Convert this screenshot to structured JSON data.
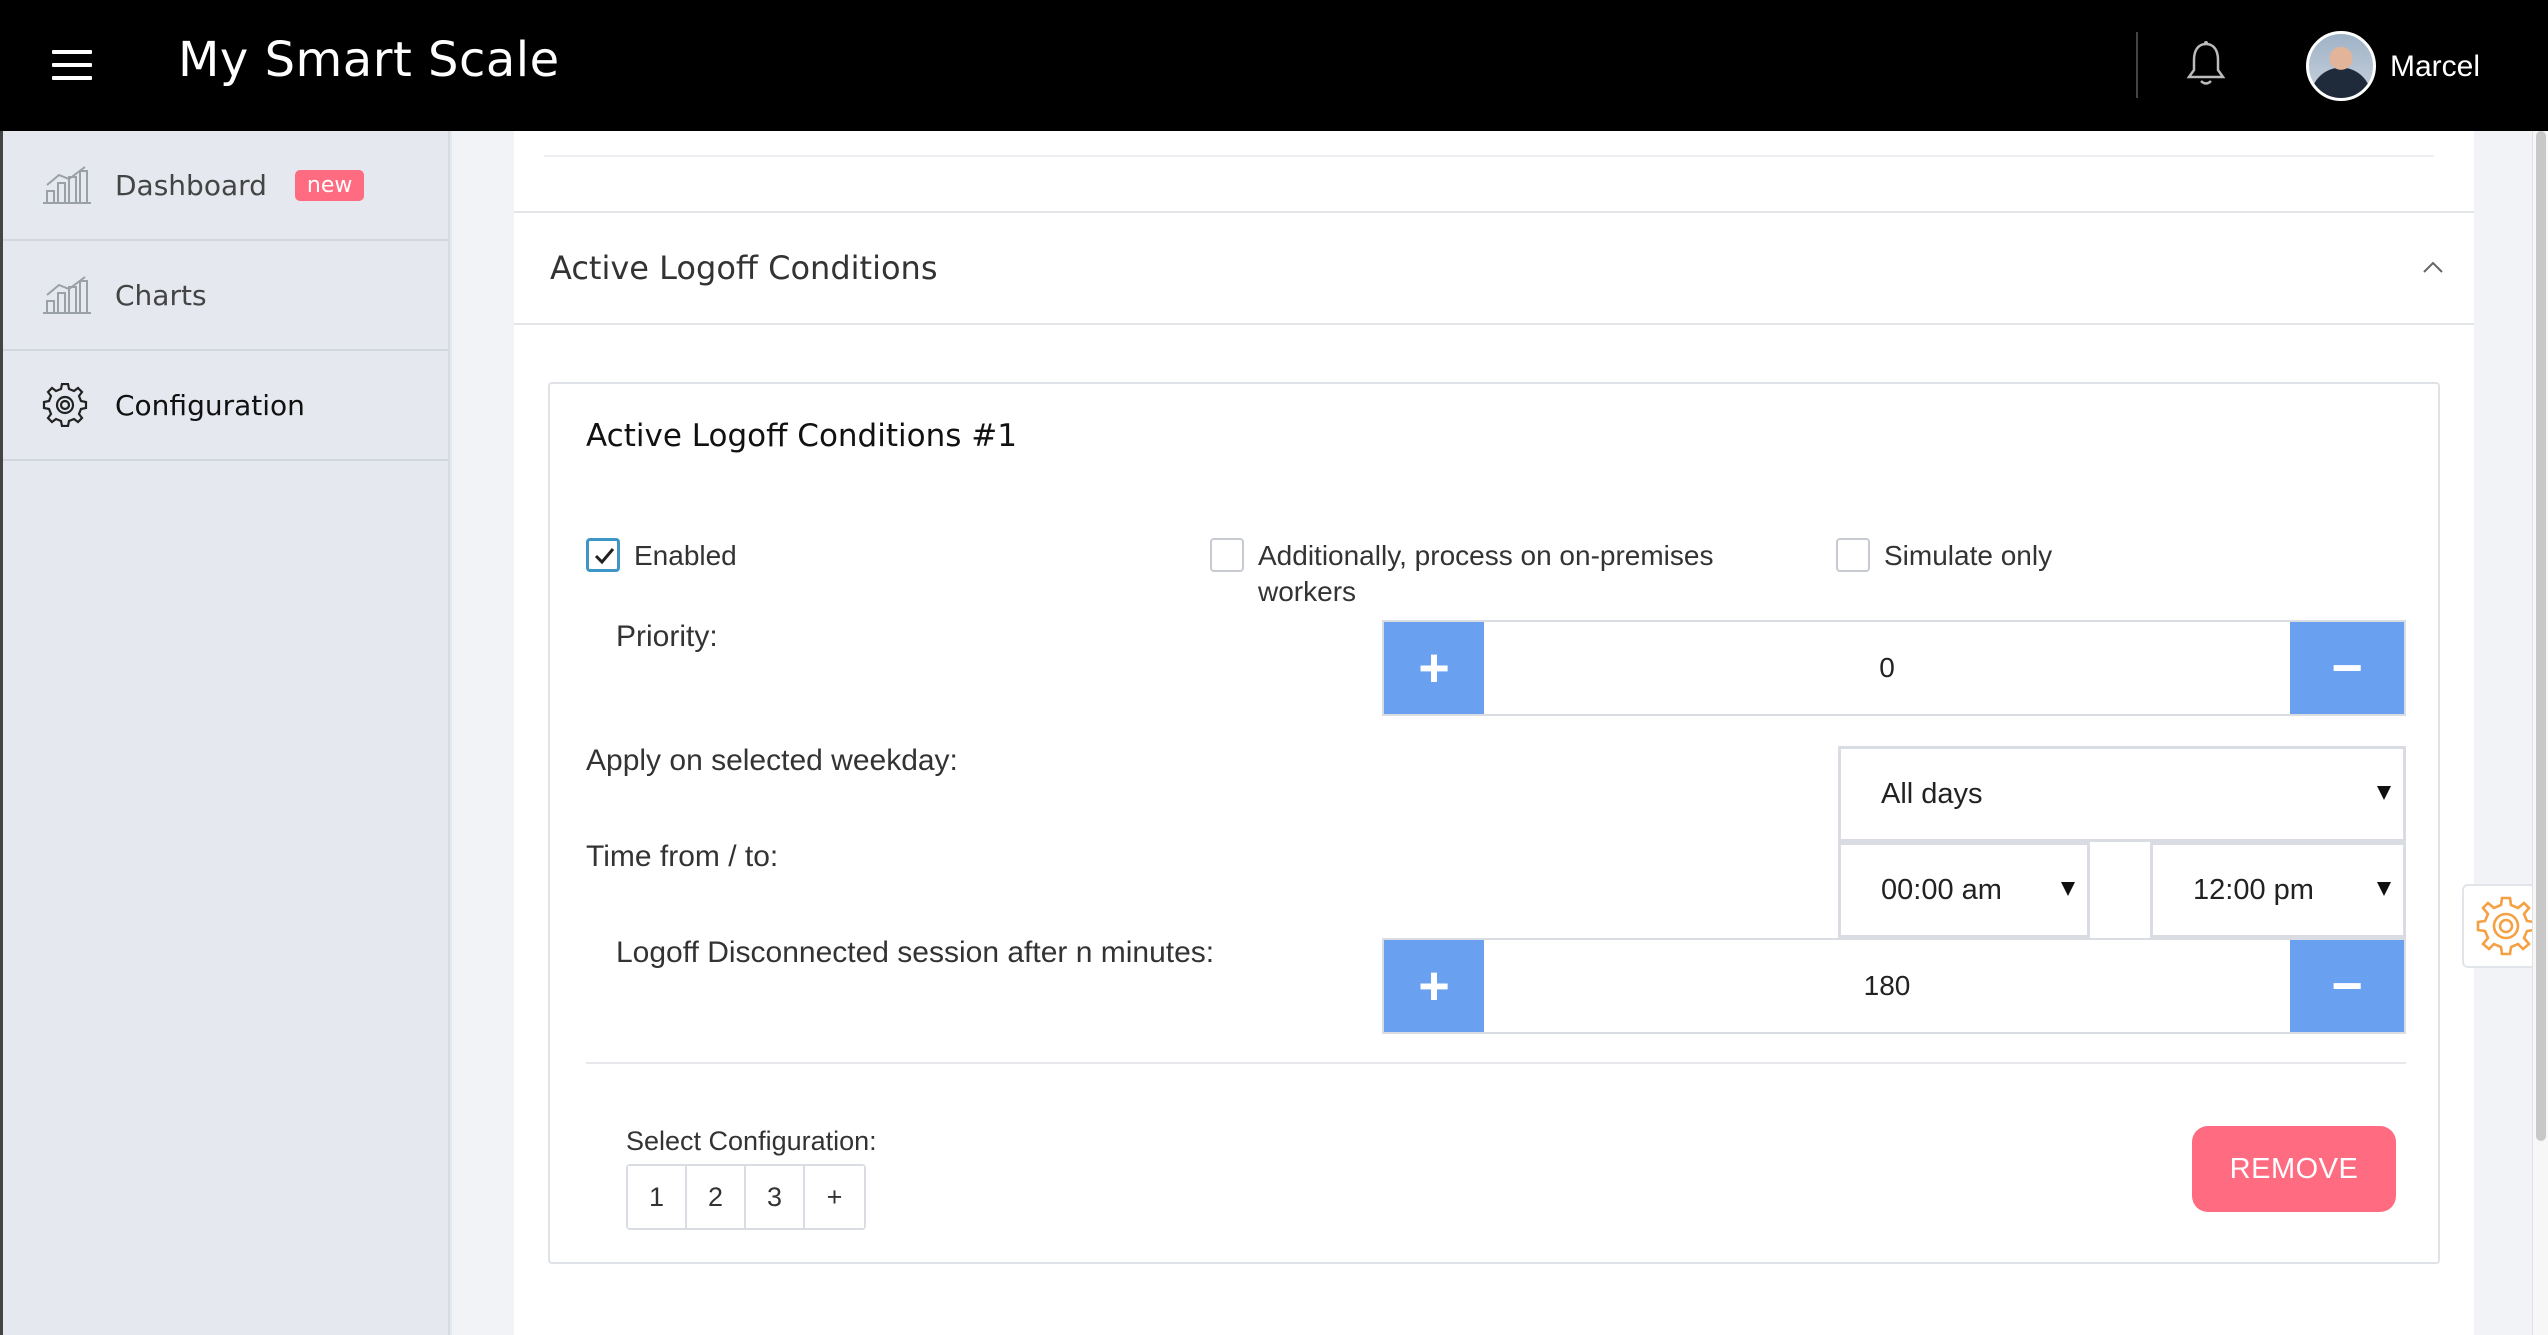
{
  "app": {
    "title": "My Smart Scale",
    "user_name": "Marcel"
  },
  "sidebar": {
    "items": [
      {
        "label": "Dashboard",
        "badge": "new",
        "icon": "bar-chart-icon"
      },
      {
        "label": "Charts",
        "icon": "bar-chart-icon"
      },
      {
        "label": "Configuration",
        "icon": "gear-icon",
        "active": true
      }
    ]
  },
  "section": {
    "title": "Active Logoff Conditions"
  },
  "card": {
    "title": "Active Logoff Conditions #1",
    "checkboxes": {
      "enabled": {
        "label": "Enabled",
        "checked": true
      },
      "on_premises": {
        "label_line1": "Additionally, process on on-premises",
        "label_line2": "workers",
        "checked": false
      },
      "simulate": {
        "label": "Simulate only",
        "checked": false
      }
    },
    "priority": {
      "label": "Priority:",
      "value": "0",
      "plus": "+",
      "minus": "−"
    },
    "weekday": {
      "label": "Apply on selected weekday:",
      "value": "All days"
    },
    "time": {
      "label": "Time from / to:",
      "from": "00:00 am",
      "to": "12:00 pm"
    },
    "logoff_minutes": {
      "label": "Logoff Disconnected session after n minutes:",
      "value": "180",
      "plus": "+",
      "minus": "−"
    },
    "select_configuration": {
      "label": "Select Configuration:",
      "options": [
        "1",
        "2",
        "3",
        "+"
      ]
    },
    "remove_label": "REMOVE"
  },
  "colors": {
    "topbar": "#000000",
    "accent_blue": "#6aa0f0",
    "remove_pink": "#ff6b81",
    "badge_pink": "#ff6b81",
    "checkbox_teal": "#3d96c6",
    "floating_gear_orange": "#f5a042"
  }
}
